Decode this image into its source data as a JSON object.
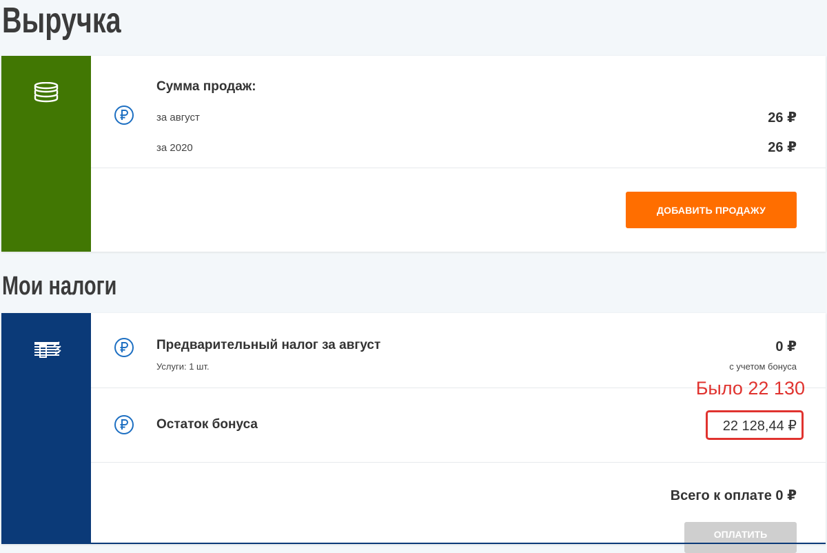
{
  "revenue": {
    "heading": "Выручка",
    "sales_title": "Сумма продаж:",
    "rows": [
      {
        "label": "за август",
        "amount": "26 ₽"
      },
      {
        "label": "за 2020",
        "amount": "26 ₽"
      }
    ],
    "add_sale_button": "ДОБАВИТЬ ПРОДАЖУ",
    "accent_color": "#417703",
    "button_color": "#ff6e00"
  },
  "taxes": {
    "heading": "Мои налоги",
    "preliminary": {
      "title": "Предварительный налог за август",
      "services": "Услуги: 1 шт.",
      "amount": "0 ₽",
      "amount_note": "с учетом бонуса"
    },
    "bonus": {
      "title": "Остаток бонуса",
      "amount": "22 128,44 ₽"
    },
    "total": "Всего к оплате 0 ₽",
    "pay_button": "ОПЛАТИТЬ",
    "accent_color": "#0b3a78"
  },
  "annotation": {
    "text": "Было 22 130",
    "color": "#e0332f"
  },
  "icons": {
    "revenue_side": "coins-stack-icon",
    "taxes_side": "documents-icon",
    "row_marker": "ruble-icon"
  }
}
